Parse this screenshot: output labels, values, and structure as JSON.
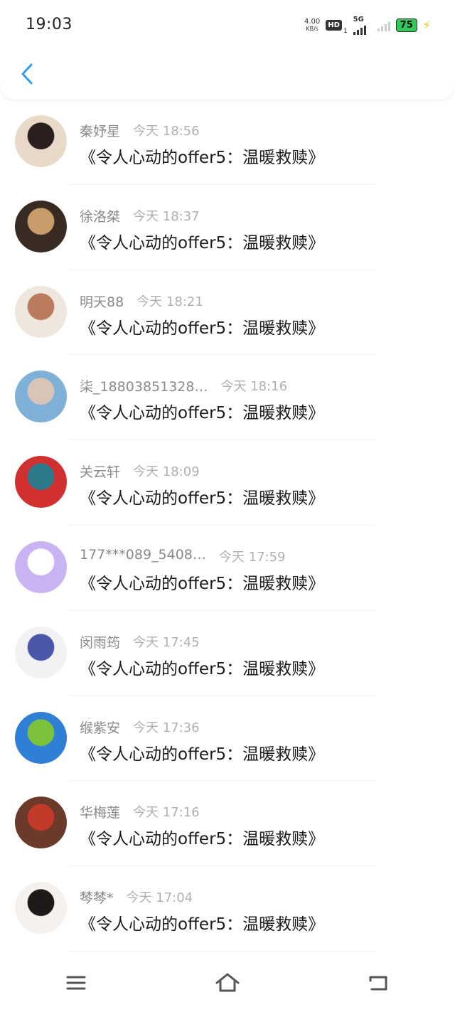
{
  "status_bar": {
    "time": "19:03",
    "net_speed_value": "4.00",
    "net_speed_unit": "KB/s",
    "hd_label": "HD",
    "sim_index": "1",
    "network_type": "5G",
    "battery": "75",
    "colors": {
      "battery": "#34c759",
      "charging": "#f5c400"
    }
  },
  "header": {
    "back_icon": "chevron-left-icon",
    "accent_color": "#2a9df4"
  },
  "items": [
    {
      "name": "秦妤星",
      "time": "今天 18:56",
      "content": "《令人心动的offer5：温暖救赎》",
      "avatar_colors": [
        "#e8d9c9",
        "#2a1f1d"
      ]
    },
    {
      "name": "徐洛桀",
      "time": "今天 18:37",
      "content": "《令人心动的offer5：温暖救赎》",
      "avatar_colors": [
        "#3a2b22",
        "#c99d6b"
      ]
    },
    {
      "name": "明天88",
      "time": "今天 18:21",
      "content": "《令人心动的offer5：温暖救赎》",
      "avatar_colors": [
        "#efe7dd",
        "#b97a5e"
      ]
    },
    {
      "name": "柒_18803851328…",
      "time": "今天 18:16",
      "content": "《令人心动的offer5：温暖救赎》",
      "avatar_colors": [
        "#7fb0d8",
        "#d9c5b8"
      ]
    },
    {
      "name": "关云轩",
      "time": "今天 18:09",
      "content": "《令人心动的offer5：温暖救赎》",
      "avatar_colors": [
        "#d03030",
        "#2c7a8c"
      ]
    },
    {
      "name": "177***089_5408…",
      "time": "今天 17:59",
      "content": "《令人心动的offer5：温暖救赎》",
      "avatar_colors": [
        "#c9b3f2",
        "#ffffff"
      ]
    },
    {
      "name": "闵雨筠",
      "time": "今天 17:45",
      "content": "《令人心动的offer5：温暖救赎》",
      "avatar_colors": [
        "#f2f2f4",
        "#4a56a8"
      ]
    },
    {
      "name": "缑紫安",
      "time": "今天 17:36",
      "content": "《令人心动的offer5：温暖救赎》",
      "avatar_colors": [
        "#2f7fd6",
        "#7cc23a"
      ]
    },
    {
      "name": "华梅莲",
      "time": "今天 17:16",
      "content": "《令人心动的offer5：温暖救赎》",
      "avatar_colors": [
        "#6b3a2a",
        "#c23a2a"
      ]
    },
    {
      "name": "棽棽*",
      "time": "今天 17:04",
      "content": "《令人心动的offer5：温暖救赎》",
      "avatar_colors": [
        "#f4f1ef",
        "#1e1a1a"
      ]
    }
  ],
  "navbar": {
    "icons": [
      "menu-icon",
      "home-icon",
      "back-return-icon"
    ],
    "color": "#555555"
  }
}
